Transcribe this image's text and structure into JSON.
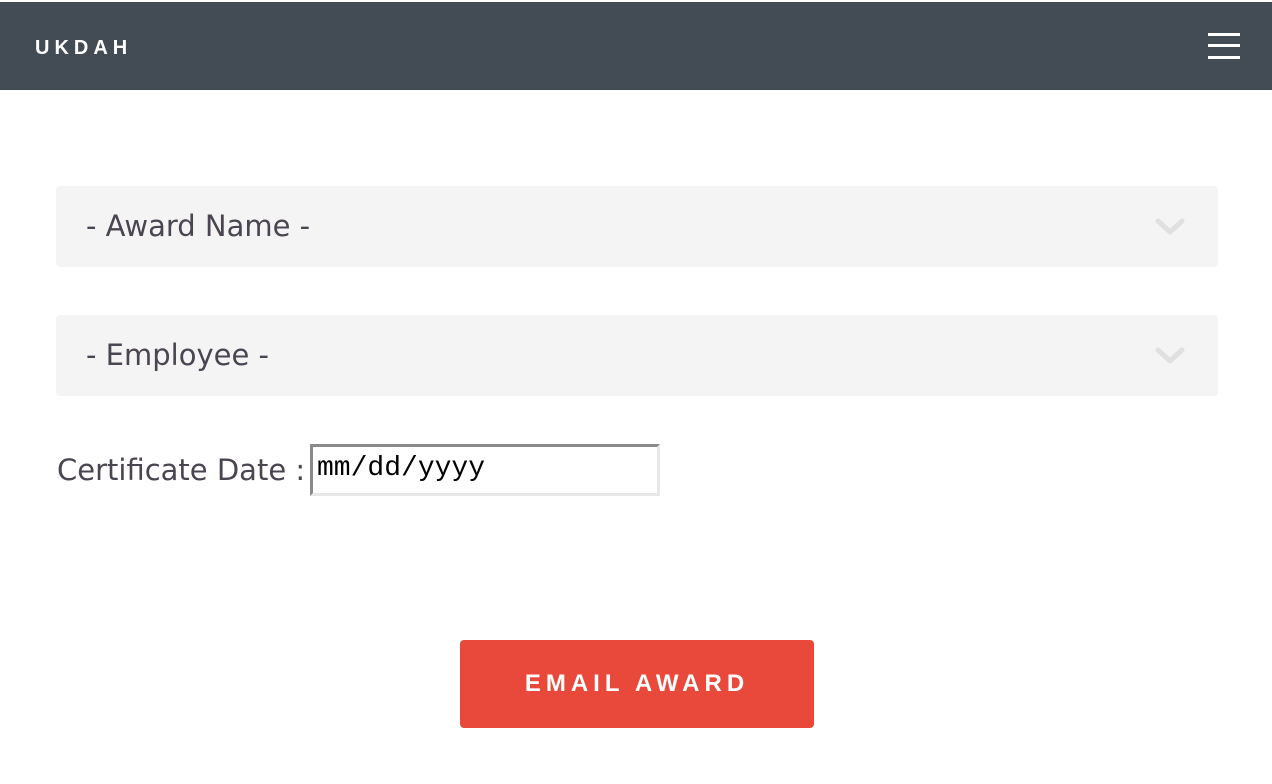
{
  "header": {
    "brand": "UKDAH",
    "menu_icon": "hamburger-menu-icon",
    "background_color": "#434c55"
  },
  "form": {
    "award_select": {
      "selected": "- Award Name -",
      "icon": "chevron-down-icon"
    },
    "employee_select": {
      "selected": "- Employee -",
      "icon": "chevron-down-icon"
    },
    "certificate_date": {
      "label": "Certificate Date :",
      "placeholder": "mm/dd/yyyy"
    },
    "submit": {
      "label": "EMAIL AWARD",
      "color": "#e8493a"
    }
  }
}
